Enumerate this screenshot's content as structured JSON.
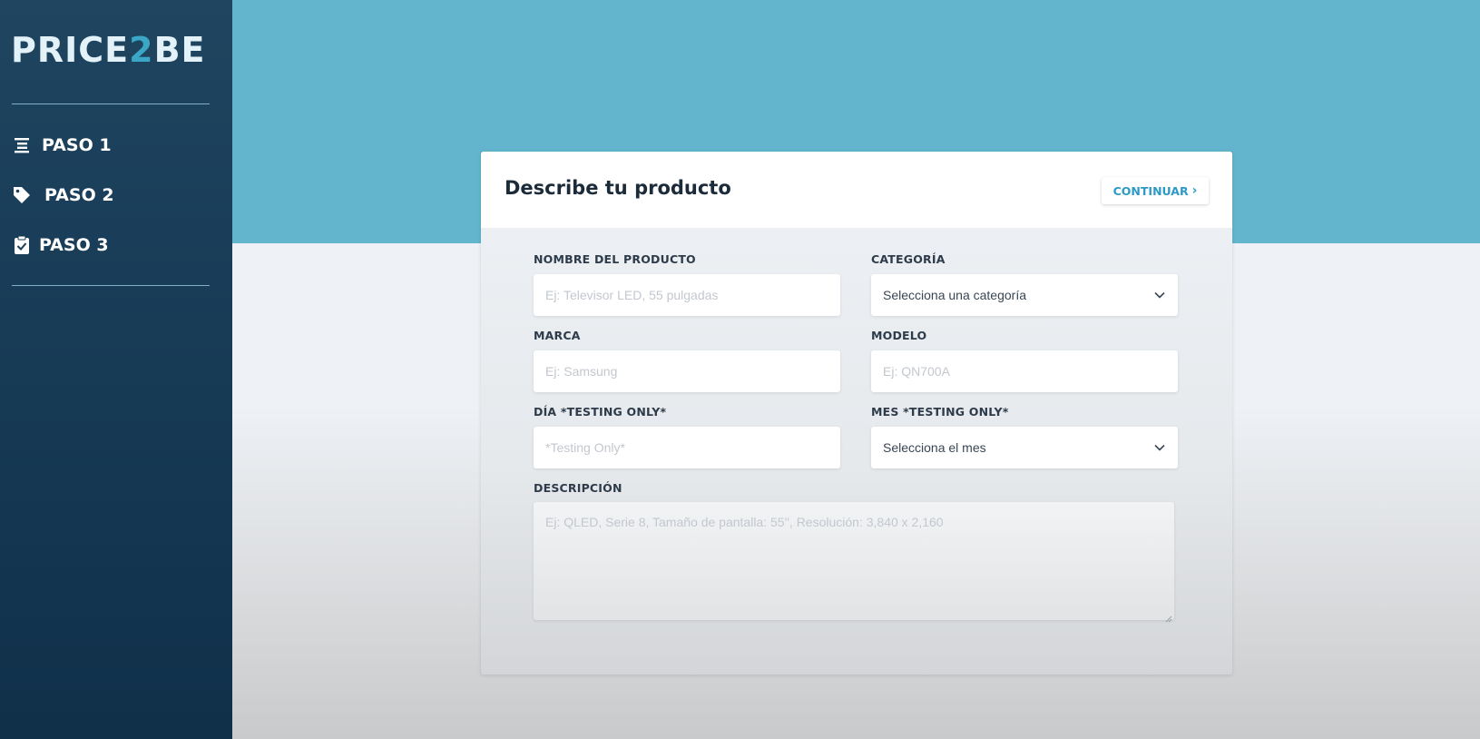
{
  "brand": {
    "logo_part1": "PRICE",
    "logo_part2": "2",
    "logo_part3": "BE"
  },
  "sidebar": {
    "items": [
      {
        "label": "PASO 1",
        "icon": "list-icon"
      },
      {
        "label": "PASO 2",
        "icon": "tag-icon"
      },
      {
        "label": "PASO 3",
        "icon": "clipboard-check-icon"
      }
    ]
  },
  "form": {
    "title": "Describe tu producto",
    "continue_label": "CONTINUAR",
    "product_name": {
      "label": "NOMBRE DEL PRODUCTO",
      "placeholder": "Ej: Televisor LED, 55 pulgadas"
    },
    "category": {
      "label": "CATEGORÍA",
      "value": "Selecciona una categoría"
    },
    "brand": {
      "label": "MARCA",
      "placeholder": "Ej: Samsung"
    },
    "model": {
      "label": "MODELO",
      "placeholder": "Ej: QN700A"
    },
    "day": {
      "label": "DÍA *TESTING ONLY*",
      "placeholder": "*Testing Only*"
    },
    "month": {
      "label": "MES *TESTING ONLY*",
      "value": "Selecciona el mes"
    },
    "description": {
      "label": "DESCRIPCIÓN",
      "placeholder": "Ej: QLED, Serie 8, Tamaño de pantalla: 55'', Resolución: 3,840 x 2,160"
    }
  },
  "colors": {
    "sidebar": "#1a3d58",
    "banner": "#62b5cc",
    "accent": "#2b9ac6"
  }
}
